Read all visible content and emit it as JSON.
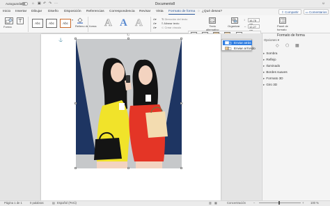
{
  "titlebar": {
    "autosave_label": "Autoguardado",
    "document_title": "Documento8",
    "traffic_colors": [
      "#fc605c",
      "#fdbc40",
      "#34c84a"
    ]
  },
  "tabs": {
    "items": [
      "Inicio",
      "Insertar",
      "Dibujar",
      "Diseño",
      "Disposición",
      "Referencias",
      "Correspondencia",
      "Revisar",
      "Vista",
      "Formato de forma"
    ],
    "active": "Formato de forma",
    "tell_me": "¿Qué desea?",
    "share_label": "Compartir",
    "comments_label": "Comentarios"
  },
  "ribbon": {
    "forma_label": "Forma",
    "cuadro_label": "Cuadro\nde texto",
    "style_samples": [
      "Abc",
      "Abc",
      "Abc"
    ],
    "relleno_label": "Relleno\nde forma",
    "wordart_letters": [
      "A",
      "A",
      "A"
    ],
    "direccion_label": "Dirección del texto",
    "alinear_label": "Alinear texto",
    "crear_vinculo_label": "Crear vínculo",
    "texto_alternativo_label": "Texto\nalternativo",
    "organizar_label": "Organizar",
    "posicion_label": "Posición",
    "ajustar_label": "Ajustar\ntexto",
    "traer_label": "Traer\nadelante",
    "enviar_label": "Enviar\natrás",
    "alinear_obj_label": "Alinear",
    "height_value": "16,78 cm",
    "width_value": "12,27 cm",
    "panel_label": "Panel de\nformato"
  },
  "send_menu": {
    "items": [
      "Enviar atrás",
      "Enviar al fondo"
    ],
    "highlighted": 0,
    "highlight_color": "#2f7de1"
  },
  "format_pane": {
    "title": "Formato de forma",
    "sections": [
      "Sombra",
      "Reflejo",
      "Iluminado",
      "Bordes suaves",
      "Formato 3D",
      "Giro 3D"
    ]
  },
  "statusbar": {
    "page": "Página 1 de 1",
    "words": "0 palabras",
    "language": "Español (Perú)",
    "focus": "Concentración",
    "zoom": "100 %"
  },
  "colors": {
    "accent": "#2b579a",
    "picture_bg_dark": "#1e3562",
    "picture_bg_light": "#c8cacc",
    "dress_red": "#e43526",
    "dress_yellow": "#f1e32a"
  }
}
